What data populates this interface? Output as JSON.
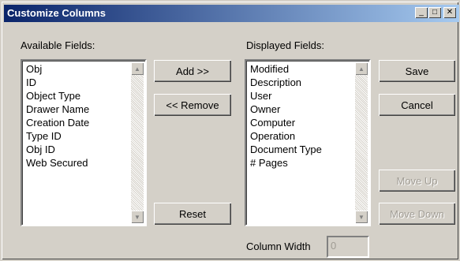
{
  "window": {
    "title": "Customize Columns",
    "controls": {
      "minimize": "_",
      "maximize": "□",
      "close": "✕"
    }
  },
  "available": {
    "label": "Available Fields:",
    "items": [
      "Obj",
      "ID",
      "Object Type",
      "Drawer Name",
      "Creation Date",
      "Type ID",
      "Obj ID",
      "Web Secured"
    ]
  },
  "displayed": {
    "label": "Displayed Fields:",
    "items": [
      "Modified",
      "Description",
      "User",
      "Owner",
      "Computer",
      "Operation",
      "Document Type",
      "# Pages"
    ]
  },
  "buttons": {
    "add": "Add >>",
    "remove": "<< Remove",
    "reset": "Reset",
    "save": "Save",
    "cancel": "Cancel",
    "move_up": "Move Up",
    "move_down": "Move Down"
  },
  "column_width": {
    "label": "Column Width",
    "value": "0"
  },
  "scroll_arrows": {
    "up": "▲",
    "down": "▼"
  },
  "colors": {
    "title_start": "#0a246a",
    "title_end": "#a6caf0",
    "face": "#d4d0c8"
  }
}
